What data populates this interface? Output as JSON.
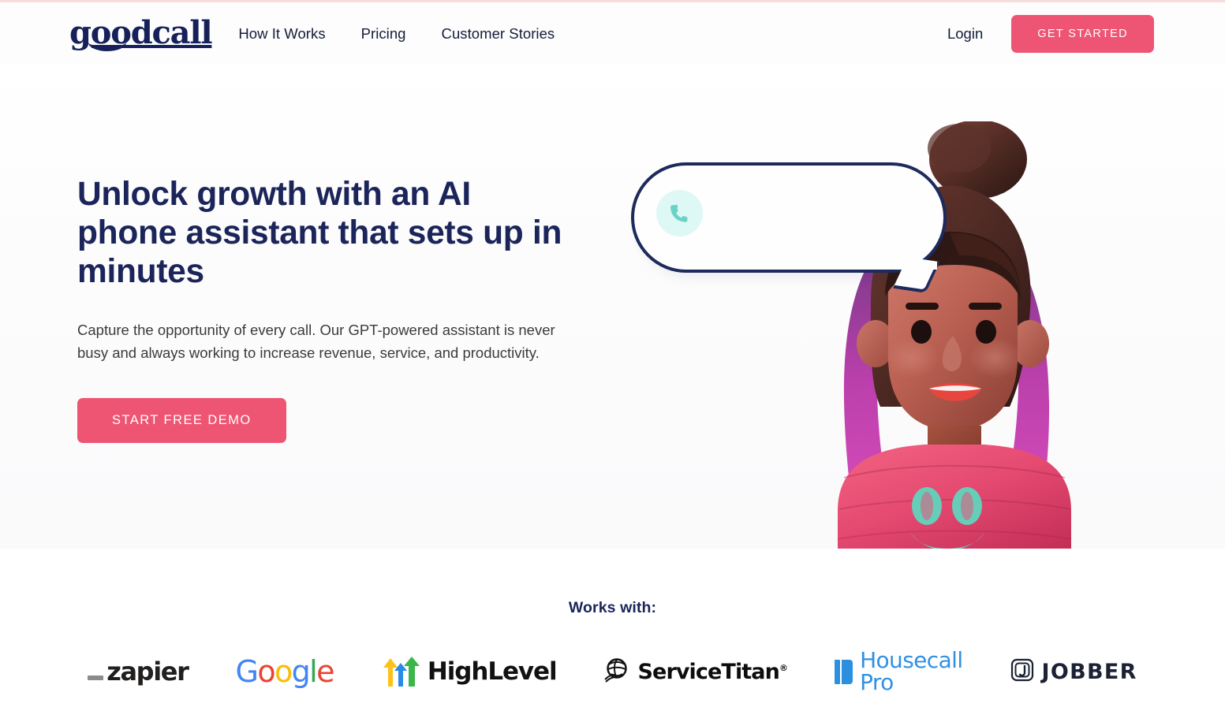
{
  "brand": {
    "logo_text": "goodcall",
    "navy": "#16205a",
    "accent_pink": "#ee5575",
    "mint": "#ddf8f5",
    "teal": "#6bd0c5"
  },
  "header": {
    "nav": [
      {
        "label": "How It Works"
      },
      {
        "label": "Pricing"
      },
      {
        "label": "Customer Stories"
      }
    ],
    "login_label": "Login",
    "cta_label": "GET STARTED"
  },
  "hero": {
    "title": "Unlock growth with an AI phone assistant that sets up in minutes",
    "subtitle": "Capture the opportunity of every call. Our GPT-powered assistant is never busy and always working to increase revenue, service, and productivity.",
    "cta_label": "START FREE DEMO",
    "bubble": {
      "icon": "phone-icon",
      "text": ""
    },
    "character": {
      "alt": "3d-illustration-woman-with-bun-hair-pink-shirt",
      "shirt_face": "smiley-face"
    }
  },
  "works_with": {
    "title": "Works with:",
    "logos": [
      {
        "name": "zapier",
        "label": "zapier"
      },
      {
        "name": "google",
        "label": "Google",
        "letters": [
          "G",
          "o",
          "o",
          "g",
          "l",
          "e"
        ]
      },
      {
        "name": "highlevel",
        "label": "HighLevel"
      },
      {
        "name": "servicetitan",
        "label": "ServiceTitan",
        "tm": "®"
      },
      {
        "name": "housecallpro",
        "label": "Housecall Pro"
      },
      {
        "name": "jobber",
        "label": "JOBBER"
      }
    ]
  }
}
